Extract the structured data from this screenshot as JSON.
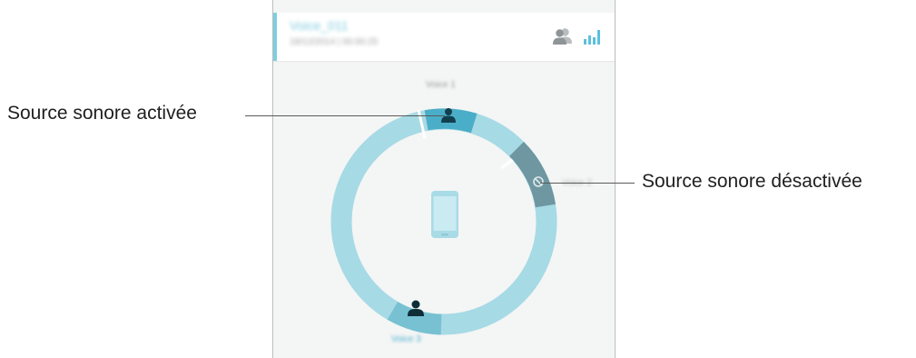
{
  "recording": {
    "title": "Voice_011",
    "meta": "18/12/2014 | 00:00:25"
  },
  "header_icons": [
    "people-icon",
    "equalizer-icon"
  ],
  "sources": [
    {
      "name": "Voice 1",
      "state": "activated",
      "icon": "person-icon"
    },
    {
      "name": "Voice 2",
      "state": "deactivated",
      "icon": "blocked-icon"
    },
    {
      "name": "Voice 3",
      "state": "activated",
      "icon": "person-icon"
    }
  ],
  "callouts": {
    "activated": "Source sonore activée",
    "deactivated": "Source sonore désactivée"
  },
  "colors": {
    "ring": "#a6dae5",
    "active_segment": "#4aaec8",
    "inactive_segment": "#6e97a2",
    "device": "#a9dbe6",
    "accent": "#7ccfe0"
  }
}
